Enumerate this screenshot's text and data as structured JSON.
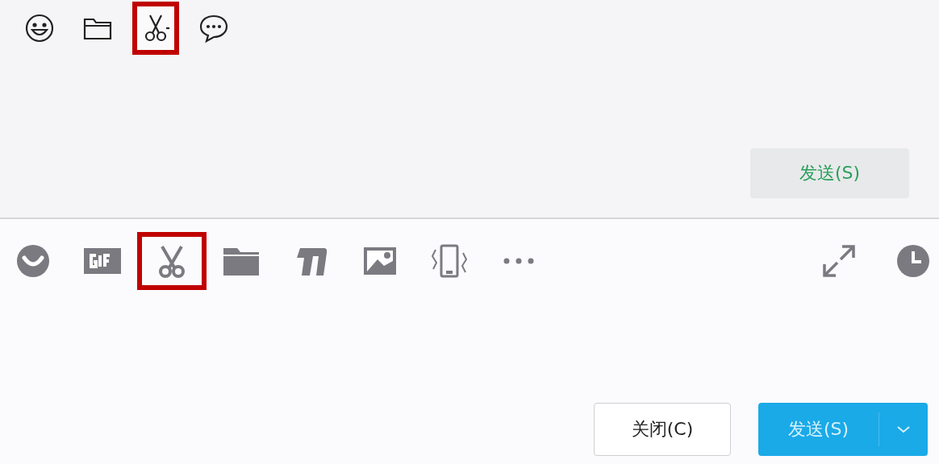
{
  "wechat": {
    "toolbar": [
      {
        "kind": "emoji",
        "highlighted": false
      },
      {
        "kind": "folder",
        "highlighted": false
      },
      {
        "kind": "scissors",
        "highlighted": true
      },
      {
        "kind": "chat",
        "highlighted": false
      }
    ],
    "send_button": "发送(S)"
  },
  "qq": {
    "toolbar": [
      {
        "kind": "emoji",
        "highlighted": false
      },
      {
        "kind": "gif",
        "highlighted": false
      },
      {
        "kind": "scissors",
        "highlighted": true
      },
      {
        "kind": "folder",
        "highlighted": false
      },
      {
        "kind": "font",
        "highlighted": false
      },
      {
        "kind": "image",
        "highlighted": false
      },
      {
        "kind": "shake",
        "highlighted": false
      },
      {
        "kind": "more",
        "highlighted": false
      }
    ],
    "right_tools": [
      {
        "kind": "expand"
      },
      {
        "kind": "clock"
      }
    ],
    "close_button": "关闭(C)",
    "send_button": "发送(S)"
  }
}
